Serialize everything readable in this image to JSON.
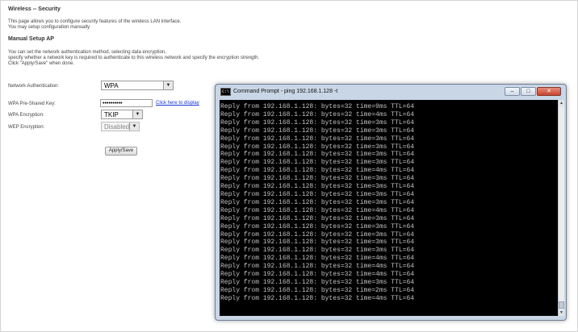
{
  "page": {
    "title": "Wireless -- Security",
    "intro_line1": "This page allows you to configure security features of the wireless LAN interface.",
    "intro_line2": "You may setup configuration manually",
    "manual_heading": "Manual Setup AP",
    "manual_line1": "You can set the network authentication method, selecting data encryption,",
    "manual_line2": "specify whether a network key is required to authenticate to this wireless network and specify the encryption strength.",
    "manual_line3": "Click \"Apply/Save\" when done."
  },
  "form": {
    "auth_label": "Network Authentication:",
    "auth_value": "WPA",
    "psk_label": "WPA Pre-Shared Key:",
    "psk_value": "••••••••••",
    "psk_link": "Click here to display",
    "wpa_enc_label": "WPA Encryption:",
    "wpa_enc_value": "TKIP",
    "wep_enc_label": "WEP Encryption:",
    "wep_enc_value": "Disabled",
    "apply_label": "Apply/Save"
  },
  "cmd": {
    "icon_text": "C:\\",
    "title": "Command Prompt - ping  192.168.1.128 -t",
    "minimize": "–",
    "maximize": "□",
    "close": "✕",
    "lines": [
      "Reply from 192.168.1.128: bytes=32 time=9ms TTL=64",
      "Reply from 192.168.1.128: bytes=32 time=4ms TTL=64",
      "Reply from 192.168.1.128: bytes=32 time=3ms TTL=64",
      "Reply from 192.168.1.128: bytes=32 time=3ms TTL=64",
      "Reply from 192.168.1.128: bytes=32 time=3ms TTL=64",
      "Reply from 192.168.1.128: bytes=32 time=3ms TTL=64",
      "Reply from 192.168.1.128: bytes=32 time=3ms TTL=64",
      "Reply from 192.168.1.128: bytes=32 time=3ms TTL=64",
      "Reply from 192.168.1.128: bytes=32 time=4ms TTL=64",
      "Reply from 192.168.1.128: bytes=32 time=3ms TTL=64",
      "Reply from 192.168.1.128: bytes=32 time=3ms TTL=64",
      "Reply from 192.168.1.128: bytes=32 time=3ms TTL=64",
      "Reply from 192.168.1.128: bytes=32 time=3ms TTL=64",
      "Reply from 192.168.1.128: bytes=32 time=4ms TTL=64",
      "Reply from 192.168.1.128: bytes=32 time=3ms TTL=64",
      "Reply from 192.168.1.128: bytes=32 time=3ms TTL=64",
      "Reply from 192.168.1.128: bytes=32 time=3ms TTL=64",
      "Reply from 192.168.1.128: bytes=32 time=3ms TTL=64",
      "Reply from 192.168.1.128: bytes=32 time=3ms TTL=64",
      "Reply from 192.168.1.128: bytes=32 time=4ms TTL=64",
      "Reply from 192.168.1.128: bytes=32 time=4ms TTL=64",
      "Reply from 192.168.1.128: bytes=32 time=4ms TTL=64",
      "Reply from 192.168.1.128: bytes=32 time=3ms TTL=64",
      "Reply from 192.168.1.128: bytes=32 time=2ms TTL=64",
      "Reply from 192.168.1.128: bytes=32 time=4ms TTL=64"
    ]
  }
}
